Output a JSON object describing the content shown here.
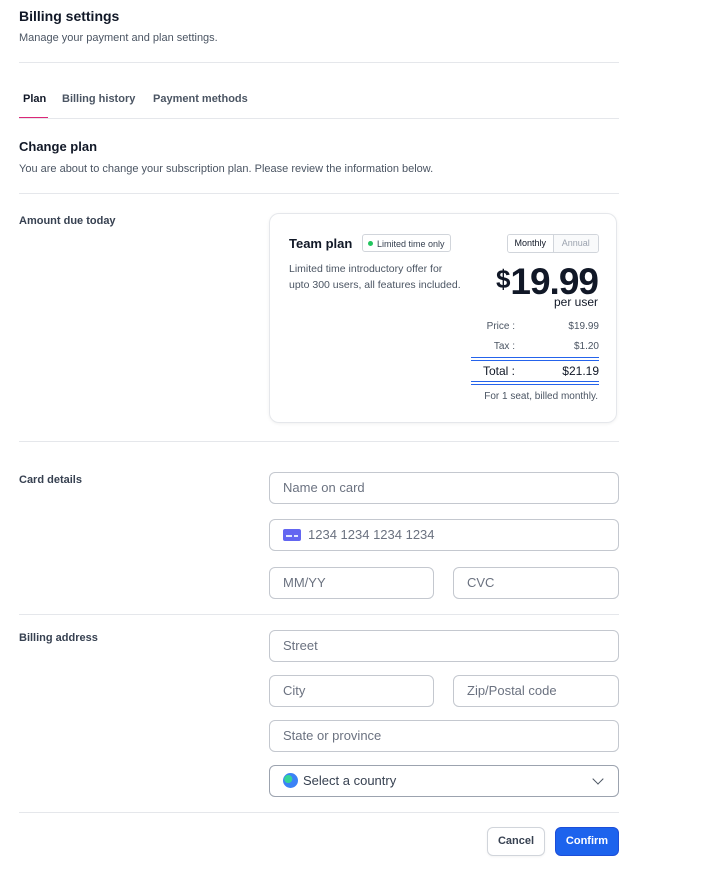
{
  "header": {
    "title": "Billing settings",
    "subtitle": "Manage your payment and plan settings."
  },
  "tabs": [
    {
      "label": "Plan",
      "active": true
    },
    {
      "label": "Billing history",
      "active": false
    },
    {
      "label": "Payment methods",
      "active": false
    }
  ],
  "change_plan": {
    "title": "Change plan",
    "description": "You are about to change your subscription plan. Please review the information below."
  },
  "amount_due": {
    "label": "Amount due today",
    "plan_name": "Team plan",
    "badge": "Limited time only",
    "plan_description": "Limited time introductory offer for upto 300 users, all features included.",
    "billing_toggle": {
      "options": [
        "Monthly",
        "Annual"
      ],
      "selected": "Monthly"
    },
    "currency_symbol": "$",
    "price": "19.99",
    "price_unit": "per user",
    "lines": [
      {
        "label": "Price :",
        "value": "$19.99"
      },
      {
        "label": "Tax :",
        "value": "$1.20"
      }
    ],
    "total_label": "Total :",
    "total_value": "$21.19",
    "seat_note": "For 1 seat, billed monthly."
  },
  "card_details": {
    "label": "Card details",
    "name_placeholder": "Name on card",
    "number_placeholder": "1234 1234 1234 1234",
    "expiry_placeholder": "MM/YY",
    "cvc_placeholder": "CVC"
  },
  "billing_address": {
    "label": "Billing address",
    "street_placeholder": "Street",
    "city_placeholder": "City",
    "zip_placeholder": "Zip/Postal code",
    "state_placeholder": "State or province",
    "country_placeholder": "Select a country"
  },
  "actions": {
    "cancel_label": "Cancel",
    "confirm_label": "Confirm"
  },
  "colors": {
    "accent": "#1d63ed",
    "tab_underline": "#db2777",
    "badge_dot": "#22c55e"
  },
  "icons": {
    "card": "credit-card-icon",
    "globe": "globe-icon",
    "chevron": "chevron-down-icon"
  }
}
